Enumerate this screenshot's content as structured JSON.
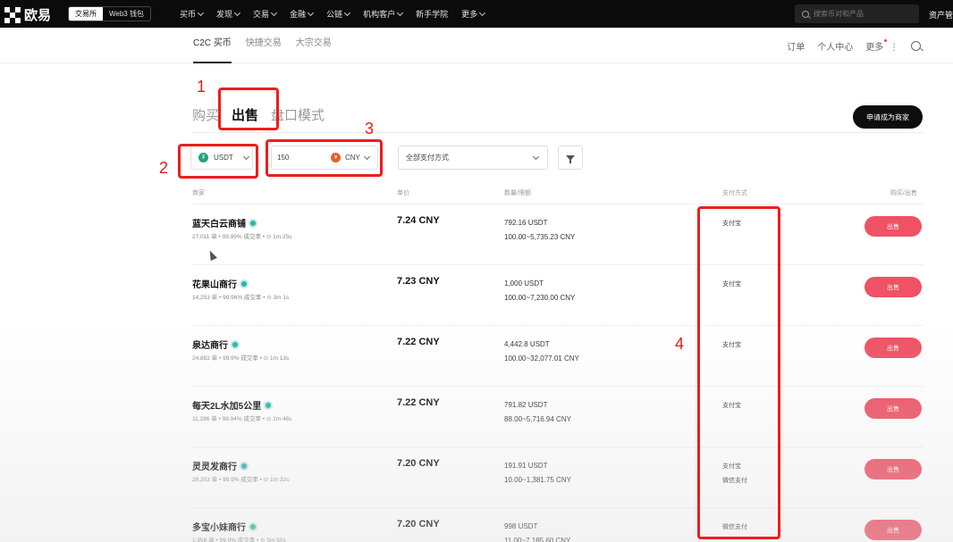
{
  "topbar": {
    "logo_text": "欧易",
    "mode_tabs": [
      "交易所",
      "Web3 钱包"
    ],
    "nav": [
      "买币",
      "发现",
      "交易",
      "金融",
      "公链",
      "机构客户",
      "新手学院",
      "更多"
    ],
    "search_placeholder": "搜索币对和产品",
    "assets_label": "资产管"
  },
  "subnav": {
    "tabs": [
      "C2C 买币",
      "快捷交易",
      "大宗交易"
    ],
    "right": {
      "orders": "订单",
      "profile": "个人中心",
      "more": "更多"
    }
  },
  "trade": {
    "tabs": [
      "购买",
      "出售",
      "盘口模式"
    ],
    "merchant_button": "申请成为商家"
  },
  "filters": {
    "coin": "USDT",
    "amount": "150",
    "fiat": "CNY",
    "payment": "全部支付方式"
  },
  "table": {
    "headers": {
      "merchant": "商家",
      "price": "单价",
      "qty": "数量/限额",
      "payment": "支付方式",
      "action": "购买/出售"
    },
    "rows": [
      {
        "name": "蓝天白云商铺",
        "stats": "27,011 单  •  99.99% 成交率  •  ⊙ 1m 25s",
        "price": "7.24 CNY",
        "qty": "792.16 USDT",
        "limit": "100.00~5,735.23 CNY",
        "pay1": "支付宝",
        "pay2": "",
        "action": "出售"
      },
      {
        "name": "花果山商行",
        "stats": "14,253 单  •  99.96% 成交率  •  ⊙ 3m 1s",
        "price": "7.23 CNY",
        "qty": "1,000 USDT",
        "limit": "100.00~7,230.00 CNY",
        "pay1": "支付宝",
        "pay2": "",
        "action": "出售"
      },
      {
        "name": "泉达商行",
        "stats": "24,882 单  •  99.9% 成交率  •  ⊙ 1m 13s",
        "price": "7.22 CNY",
        "qty": "4,442.8 USDT",
        "limit": "100.00~32,077.01 CNY",
        "pay1": "支付宝",
        "pay2": "",
        "action": "出售"
      },
      {
        "name": "每天2L水加5公里",
        "stats": "11,286 单  •  99.94% 成交率  •  ⊙ 1m 46s",
        "price": "7.22 CNY",
        "qty": "791.82 USDT",
        "limit": "88.00~5,716.94 CNY",
        "pay1": "支付宝",
        "pay2": "",
        "action": "出售"
      },
      {
        "name": "灵灵发商行",
        "stats": "28,253 单  •  99.9% 成交率  •  ⊙ 1m 32s",
        "price": "7.20 CNY",
        "qty": "191.91 USDT",
        "limit": "10.00~1,381.75 CNY",
        "pay1": "支付宝",
        "pay2": "微信支付",
        "action": "出售"
      },
      {
        "name": "多宝小妹商行",
        "stats": "1,958 单  •  99.9% 成交率  •  ⊙ 5m 50s",
        "price": "7.20 CNY",
        "qty": "998 USDT",
        "limit": "11.00~7,185.60 CNY",
        "pay1": "微信支付",
        "pay2": "",
        "action": "出售"
      }
    ]
  },
  "annotations": [
    "1",
    "2",
    "3",
    "4"
  ],
  "colors": {
    "annotation": "#ee1c1c",
    "sell_button": "#ee5264",
    "usdt": "#26a17b",
    "topbar": "#0b0b0b"
  }
}
